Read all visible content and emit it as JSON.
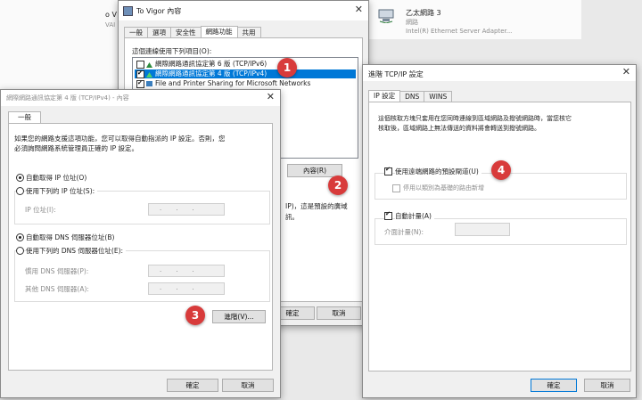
{
  "background": {
    "adapter_name": "乙太網路 3",
    "adapter_status": "網路",
    "adapter_device": "Intel(R) Ethernet Server Adapter...",
    "left_fragment_1": "o V",
    "left_fragment_2": "VAI"
  },
  "vigor_window": {
    "title": "To Vigor 內容",
    "tabs": [
      "一般",
      "選項",
      "安全性",
      "網路功能",
      "共用"
    ],
    "active_tab": "網路功能",
    "list_caption": "這個連線使用下列項目(O):",
    "items": [
      {
        "label": "網際網路通訊協定第 6 版 (TCP/IPv6)",
        "checked": false
      },
      {
        "label": "網際網路通訊協定第 4 版 (TCP/IPv4)",
        "checked": true
      },
      {
        "label": "File and Printer Sharing for Microsoft Networks",
        "checked": true
      }
    ],
    "properties_button": "內容(R)",
    "desc_fragment_1": "IP)，這是預設的廣域",
    "desc_fragment_2": "訊。",
    "ok_fragment": "確定",
    "cancel_button": "取消"
  },
  "ipv4_window": {
    "title": "網際網路通訊協定第 4 版 (TCP/IPv4) - 內容",
    "tab": "一般",
    "intro_line1": "如果您的網路支援這項功能，您可以取得自動指派的 IP 設定。否則，您",
    "intro_line2": "必須詢問網路系統管理員正確的 IP 設定。",
    "auto_ip": "自動取得 IP 位址(O)",
    "manual_ip": "使用下列的 IP 位址(S):",
    "ip_label": "IP 位址(I):",
    "auto_dns": "自動取得 DNS 伺服器位址(B)",
    "manual_dns": "使用下列的 DNS 伺服器位址(E):",
    "preferred_dns": "慣用 DNS 伺服器(P):",
    "alternate_dns": "其他 DNS 伺服器(A):",
    "advanced_button": "進階(V)...",
    "ok_button": "確定",
    "cancel_button": "取消"
  },
  "advanced_window": {
    "title": "進階 TCP/IP 設定",
    "tabs": [
      "IP 設定",
      "DNS",
      "WINS"
    ],
    "active_tab": "IP 設定",
    "desc_line1": "這個核取方塊只套用在您同時連線到區域網路及撥號網路時，當您核它",
    "desc_line2": "核取後，區域網路上無法傳送的資料將會轉送到撥號網路。",
    "use_gateway": "使用遠端網路的預設閘道(U)",
    "disable_class": "停用以類別為基礎的路由新增",
    "auto_metric": "自動計量(A)",
    "metric_label": "介面計量(N):",
    "ok_button": "確定",
    "cancel_button": "取消"
  },
  "step_badges": [
    "1",
    "2",
    "3",
    "4"
  ],
  "colors": {
    "badge": "#d83b3b",
    "selection": "#0078d7"
  }
}
